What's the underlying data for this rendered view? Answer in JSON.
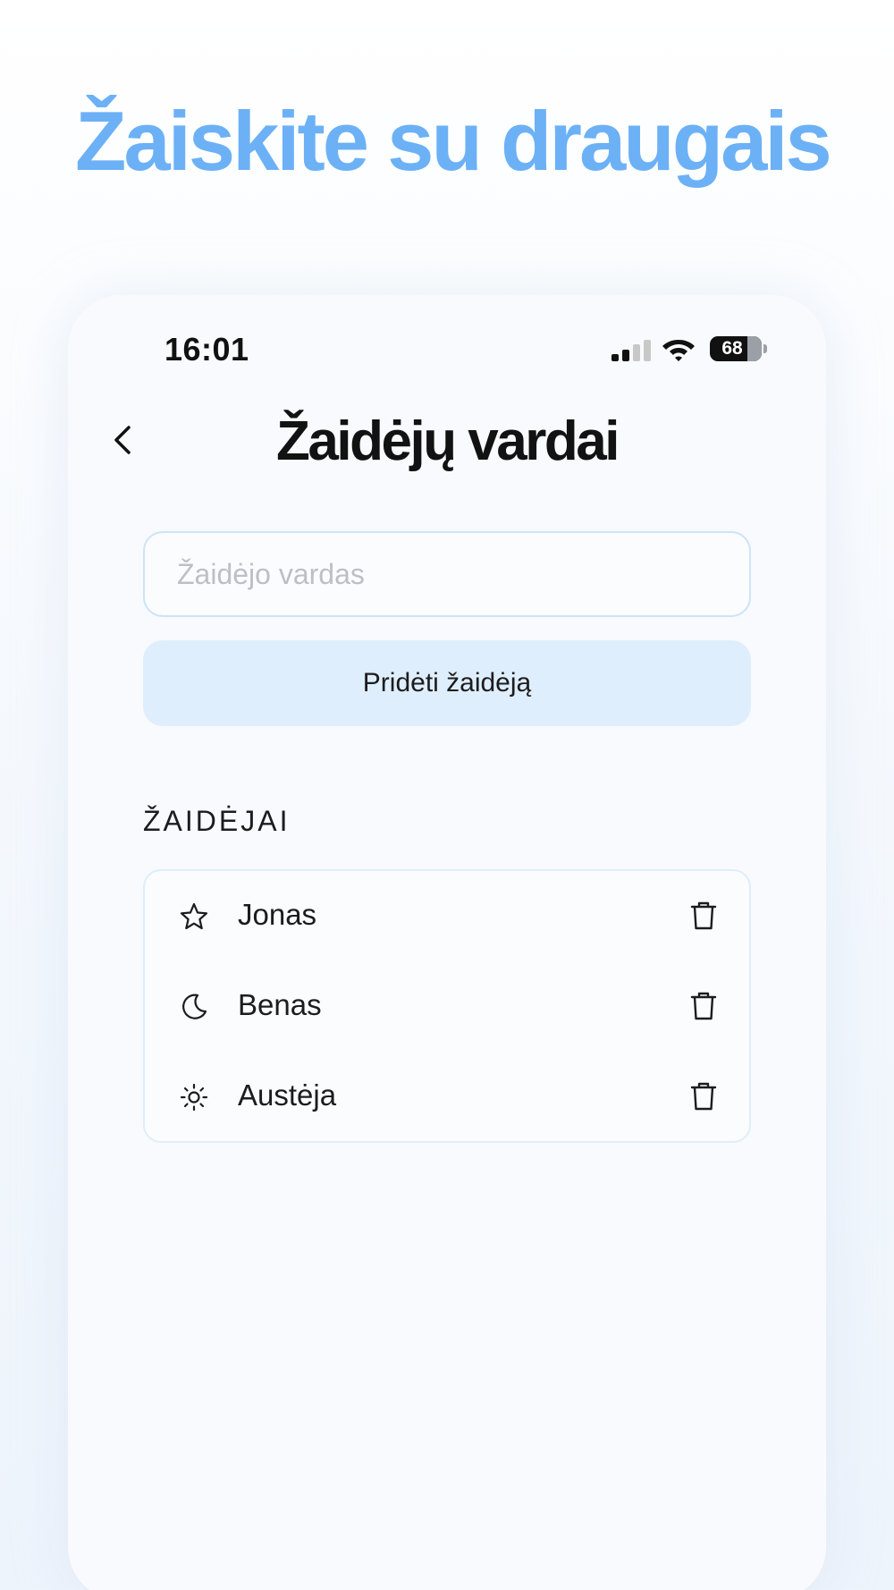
{
  "headline": "Žaiskite su draugais",
  "status_bar": {
    "time": "16:01",
    "battery": "68"
  },
  "nav": {
    "title": "Žaidėjų vardai",
    "back_icon": "chevron-left-icon"
  },
  "form": {
    "input_placeholder": "Žaidėjo vardas",
    "input_value": "",
    "add_button_label": "Pridėti žaidėją"
  },
  "players_section": {
    "label": "ŽAIDĖJAI",
    "players": [
      {
        "name": "Jonas",
        "icon": "star-icon"
      },
      {
        "name": "Benas",
        "icon": "moon-icon"
      },
      {
        "name": "Austėja",
        "icon": "sun-icon"
      }
    ]
  },
  "colors": {
    "headline": "#6cb1f6",
    "button_bg": "#dfeefc",
    "border": "#cde4f7"
  }
}
